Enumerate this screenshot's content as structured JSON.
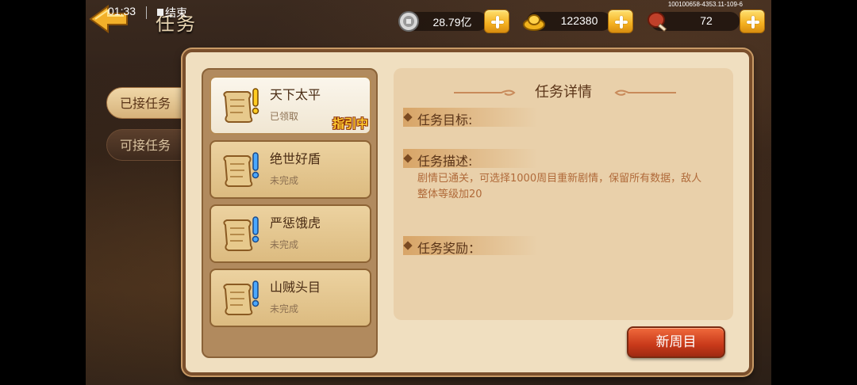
{
  "header": {
    "title": "任务",
    "clock": "01:33",
    "record_end_label": "结束",
    "build_id": "100100658-4353.11-109-6"
  },
  "currency": {
    "silver": "28.79亿",
    "gold": "122380",
    "stamina": "72"
  },
  "side_tabs": {
    "accepted": "已接任务",
    "available": "可接任务",
    "selected": "accepted"
  },
  "quests": [
    {
      "name": "天下太平",
      "status": "已领取",
      "badge": "指引中",
      "selected": true
    },
    {
      "name": "绝世好盾",
      "status": "未完成"
    },
    {
      "name": "严惩饿虎",
      "status": "未完成"
    },
    {
      "name": "山贼头目",
      "status": "未完成"
    }
  ],
  "detail": {
    "title": "任务详情",
    "goal_label": "任务目标:",
    "desc_label": "任务描述:",
    "desc_text": "剧情已通关，可选择1000周目重新剧情，保留所有数据，敌人整体等级加20",
    "reward_label": "任务奖励："
  },
  "buttons": {
    "new_cycle": "新周目"
  },
  "colors": {
    "panel_bg": "#f0dfc0",
    "accent_orange": "#c8391a",
    "plus_gold": "#f4b020"
  }
}
